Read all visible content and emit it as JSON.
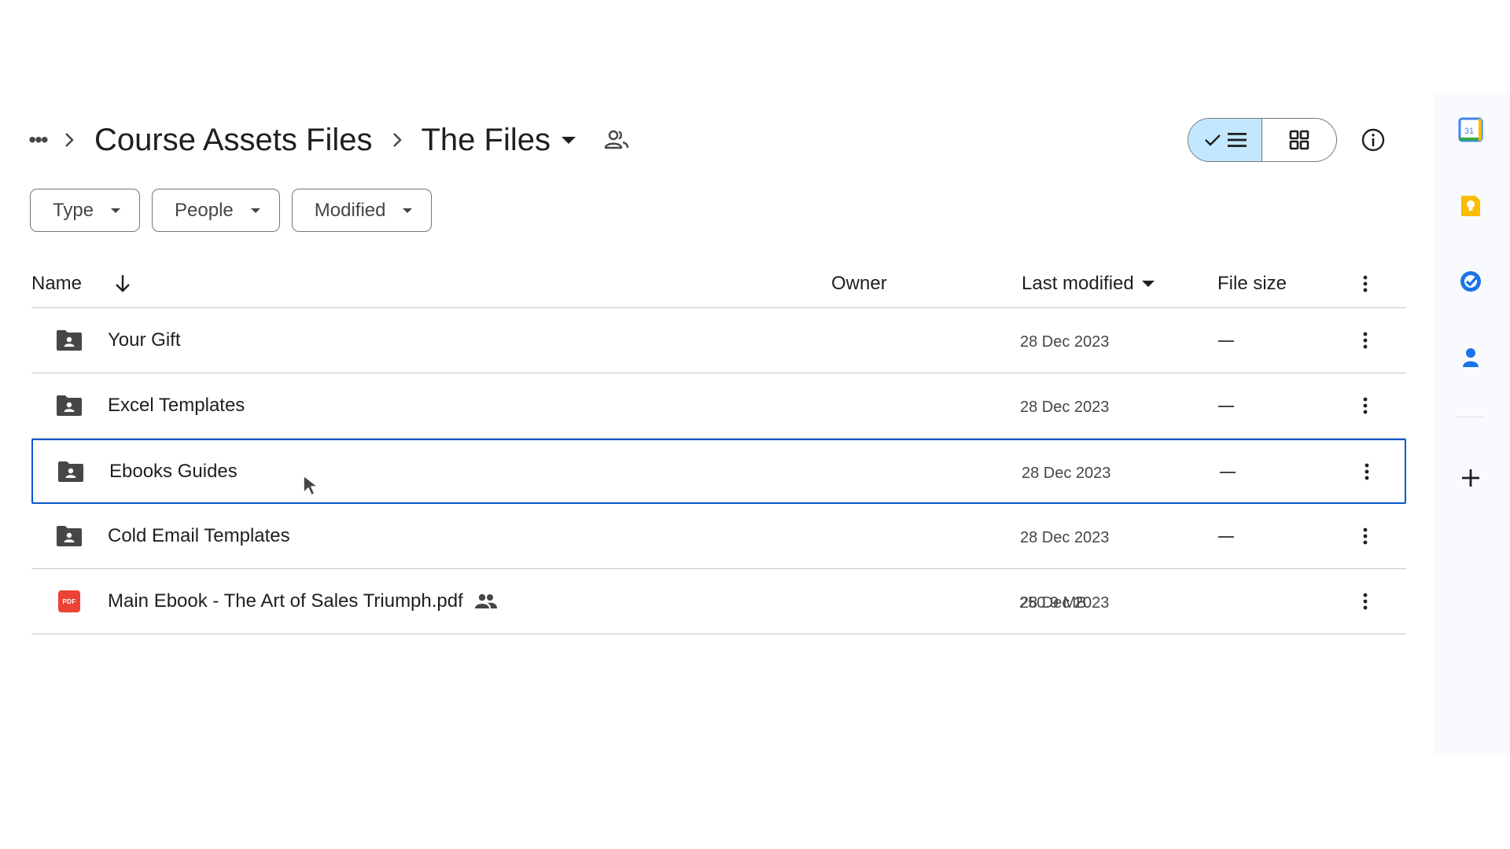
{
  "breadcrumb": {
    "more_label": "•••",
    "parent": "Course Assets Files",
    "current": "The Files"
  },
  "view_toggle": {
    "active": "list"
  },
  "filters": [
    {
      "label": "Type"
    },
    {
      "label": "People"
    },
    {
      "label": "Modified"
    }
  ],
  "table": {
    "columns": {
      "name": "Name",
      "owner": "Owner",
      "last_modified": "Last modified",
      "file_size": "File size"
    },
    "rows": [
      {
        "name": "Your Gift",
        "type": "shared-folder",
        "modified": "28 Dec 2023",
        "size": "—"
      },
      {
        "name": "Excel Templates",
        "type": "shared-folder",
        "modified": "28 Dec 2023",
        "size": "—"
      },
      {
        "name": "Ebooks Guides",
        "type": "shared-folder",
        "modified": "28 Dec 2023",
        "size": "—",
        "selected": true
      },
      {
        "name": "Cold Email Templates",
        "type": "shared-folder",
        "modified": "28 Dec 2023",
        "size": "—"
      },
      {
        "name": "Main Ebook - The Art of Sales Triumph.pdf",
        "type": "pdf",
        "shared": true,
        "modified": "28 Dec 2023",
        "size": "250.9 MB"
      }
    ]
  },
  "pdf_badge_label": "PDF",
  "side_panel": {
    "apps": [
      "calendar-icon",
      "keep-icon",
      "tasks-icon",
      "contacts-icon"
    ],
    "calendar_day": "31"
  },
  "colors": {
    "selected_border": "#0b57d0",
    "toggle_active": "#c2e7ff",
    "pdf_red": "#ea4335"
  }
}
